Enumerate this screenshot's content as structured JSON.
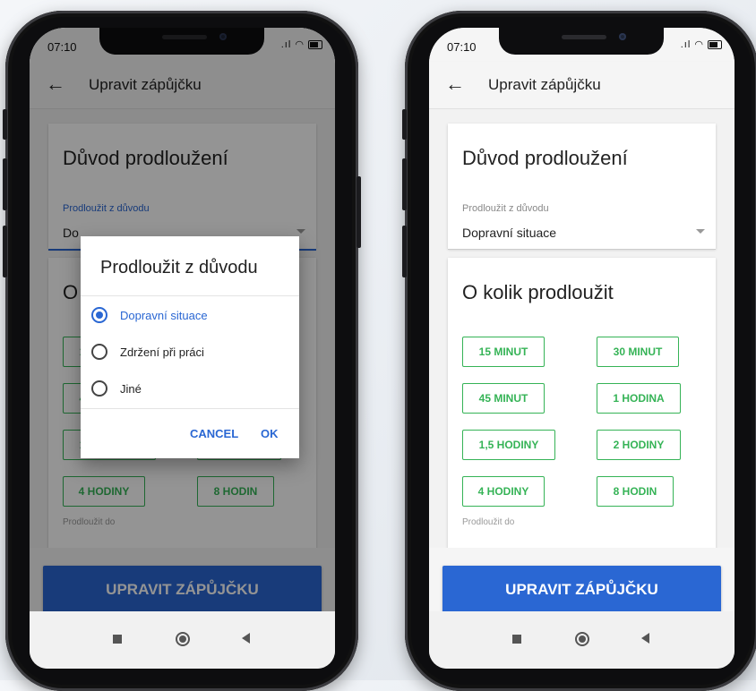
{
  "status": {
    "time": "07:10",
    "signal": ".ıl"
  },
  "appbar": {
    "back": "←",
    "title": "Upravit zápůjčku"
  },
  "reason_card": {
    "title": "Důvod prodloužení",
    "field_label": "Prodloužit z důvodu",
    "field_value": "Dopravní situace",
    "field_value_partial": "Do"
  },
  "extend_card": {
    "title": "O kolik prodloužit",
    "title_partial": "O",
    "options": [
      "15 MINUT",
      "30 MINUT",
      "45 MINUT",
      "1 HODINA",
      "1,5 HODINY",
      "2 HODINY",
      "4 HODINY",
      "8 HODIN"
    ],
    "below_label_partial": "Prodloužit do"
  },
  "main_button": {
    "label": "UPRAVIT ZÁPŮJČKU"
  },
  "dialog": {
    "title": "Prodloužit z důvodu",
    "options": [
      "Dopravní situace",
      "Zdržení při práci",
      "Jiné"
    ],
    "selected_index": 0,
    "cancel": "CANCEL",
    "ok": "OK"
  },
  "colors": {
    "accent": "#2a67d3",
    "chip_green": "#35b356"
  }
}
